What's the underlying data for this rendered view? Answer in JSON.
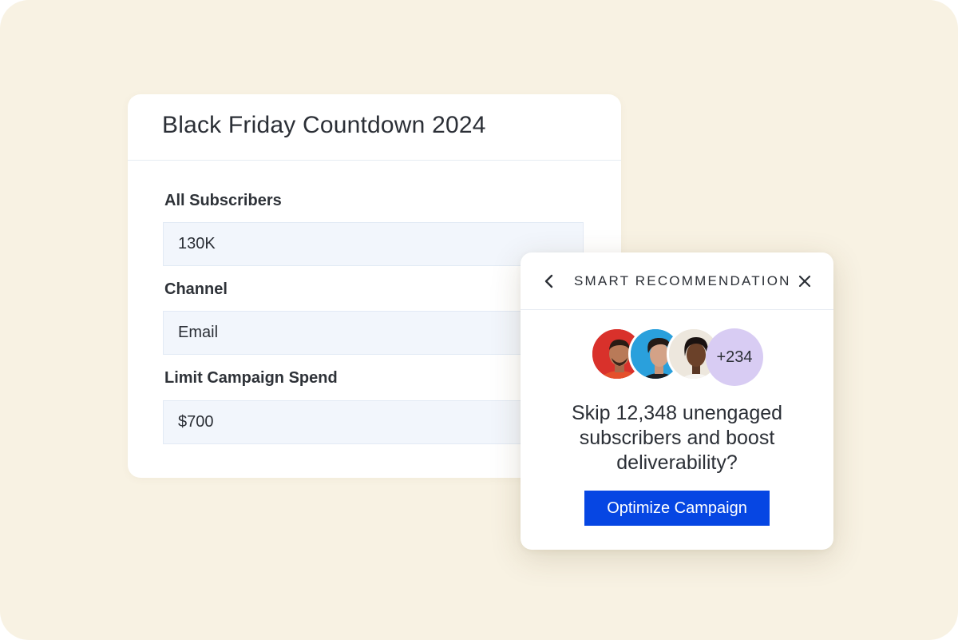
{
  "campaign": {
    "title": "Black Friday Countdown 2024",
    "fields": [
      {
        "label": "All Subscribers",
        "value": "130K"
      },
      {
        "label": "Channel",
        "value": "Email"
      },
      {
        "label": "Limit Campaign Spend",
        "value": "$700"
      }
    ]
  },
  "recommendation": {
    "title": "SMART RECOMMENDATION",
    "back_icon": "chevron-left-icon",
    "close_icon": "close-icon",
    "extra_count": "+234",
    "message_lines": [
      "Skip 12,348 unengaged",
      "subscribers and boost",
      "deliverability?"
    ],
    "button_label": "Optimize Campaign",
    "button_color": "#0646e3"
  },
  "colors": {
    "background": "#f8f2e3",
    "count_badge": "#d8ccf3"
  }
}
